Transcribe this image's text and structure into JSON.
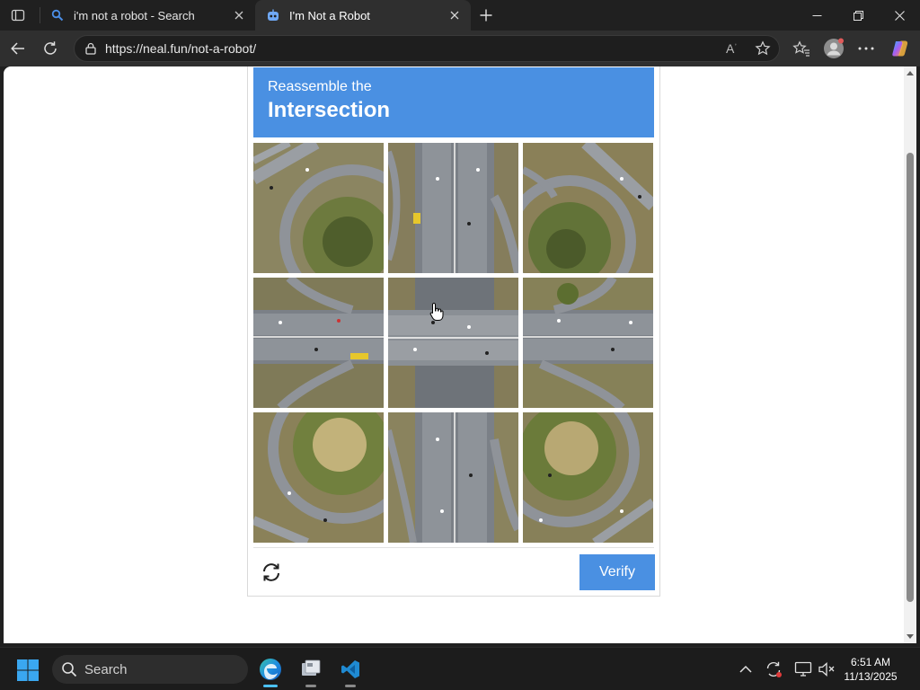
{
  "browser": {
    "tabs": [
      {
        "title": "i'm not a robot - Search",
        "active": false,
        "icon": "bing-search-icon"
      },
      {
        "title": "I'm Not a Robot",
        "active": true,
        "icon": "robot-icon"
      }
    ],
    "url": "https://neal.fun/not-a-robot/"
  },
  "captcha": {
    "subtitle": "Reassemble the",
    "title": "Intersection",
    "verify_label": "Verify",
    "accent_color": "#4a90e2",
    "tiles": [
      "tile-1",
      "tile-2",
      "tile-3",
      "tile-4",
      "tile-5",
      "tile-6",
      "tile-7",
      "tile-8",
      "tile-9"
    ]
  },
  "taskbar": {
    "search_placeholder": "Search",
    "time": "6:51 AM",
    "date": "11/13/2025"
  }
}
